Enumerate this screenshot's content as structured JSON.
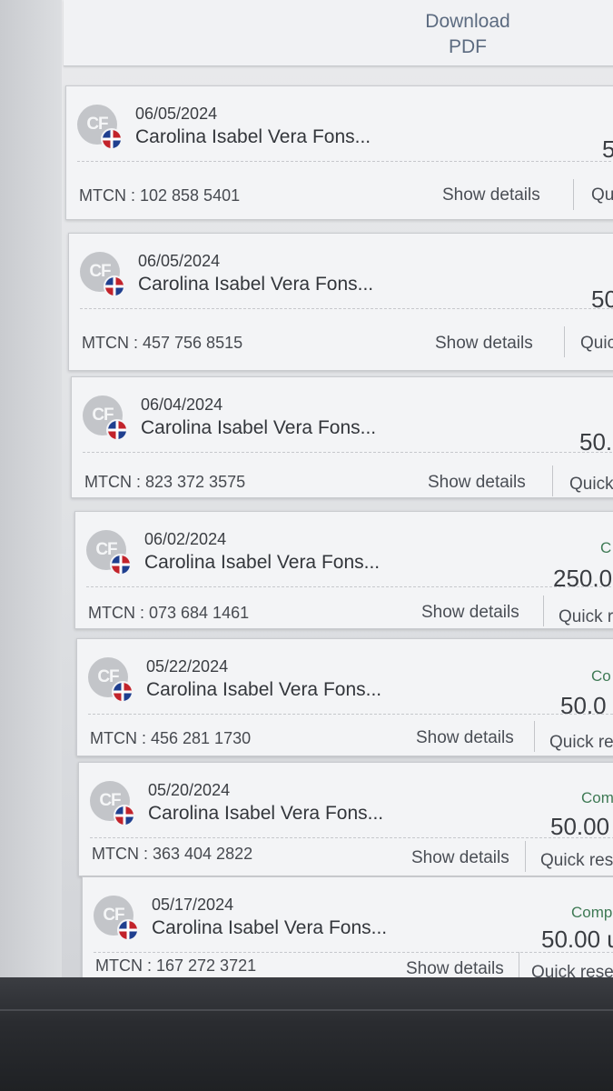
{
  "header": {
    "download_label": "Download\nPDF"
  },
  "colors": {
    "status_green": "#3f7a55",
    "flag_blue": "#1f3f8f",
    "flag_red": "#c2232b"
  },
  "transactions": [
    {
      "date": "06/05/2024",
      "name": "Carolina Isabel Vera Fons...",
      "initials": "CF",
      "flag_icon": "dominican-flag-icon",
      "status": "",
      "amount": "5",
      "mtcn": "MTCN : 102 858 5401",
      "show_details": "Show details",
      "quick_resend": "Qu"
    },
    {
      "date": "06/05/2024",
      "name": "Carolina Isabel Vera Fons...",
      "initials": "CF",
      "flag_icon": "dominican-flag-icon",
      "status": "",
      "amount": "50",
      "mtcn": "MTCN : 457 756 8515",
      "show_details": "Show details",
      "quick_resend": "Quic"
    },
    {
      "date": "06/04/2024",
      "name": "Carolina Isabel Vera Fons...",
      "initials": "CF",
      "flag_icon": "dominican-flag-icon",
      "status": "",
      "amount": "50.",
      "mtcn": "MTCN : 823 372 3575",
      "show_details": "Show details",
      "quick_resend": "Quick"
    },
    {
      "date": "06/02/2024",
      "name": "Carolina Isabel Vera Fons...",
      "initials": "CF",
      "flag_icon": "dominican-flag-icon",
      "status": "C",
      "amount": "250.0",
      "mtcn": "MTCN : 073 684 1461",
      "show_details": "Show details",
      "quick_resend": "Quick r"
    },
    {
      "date": "05/22/2024",
      "name": "Carolina Isabel Vera Fons...",
      "initials": "CF",
      "flag_icon": "dominican-flag-icon",
      "status": "Co",
      "amount": "50.0",
      "mtcn": "MTCN : 456 281 1730",
      "show_details": "Show details",
      "quick_resend": "Quick re"
    },
    {
      "date": "05/20/2024",
      "name": "Carolina Isabel Vera Fons...",
      "initials": "CF",
      "flag_icon": "dominican-flag-icon",
      "status": "Com",
      "amount": "50.00",
      "mtcn": "MTCN : 363 404 2822",
      "show_details": "Show details",
      "quick_resend": "Quick res"
    },
    {
      "date": "05/17/2024",
      "name": "Carolina Isabel Vera Fons...",
      "initials": "CF",
      "flag_icon": "dominican-flag-icon",
      "status": "Comp",
      "amount": "50.00 u",
      "mtcn": "MTCN : 167 272 3721",
      "show_details": "Show details",
      "quick_resend": "Quick reser"
    }
  ]
}
